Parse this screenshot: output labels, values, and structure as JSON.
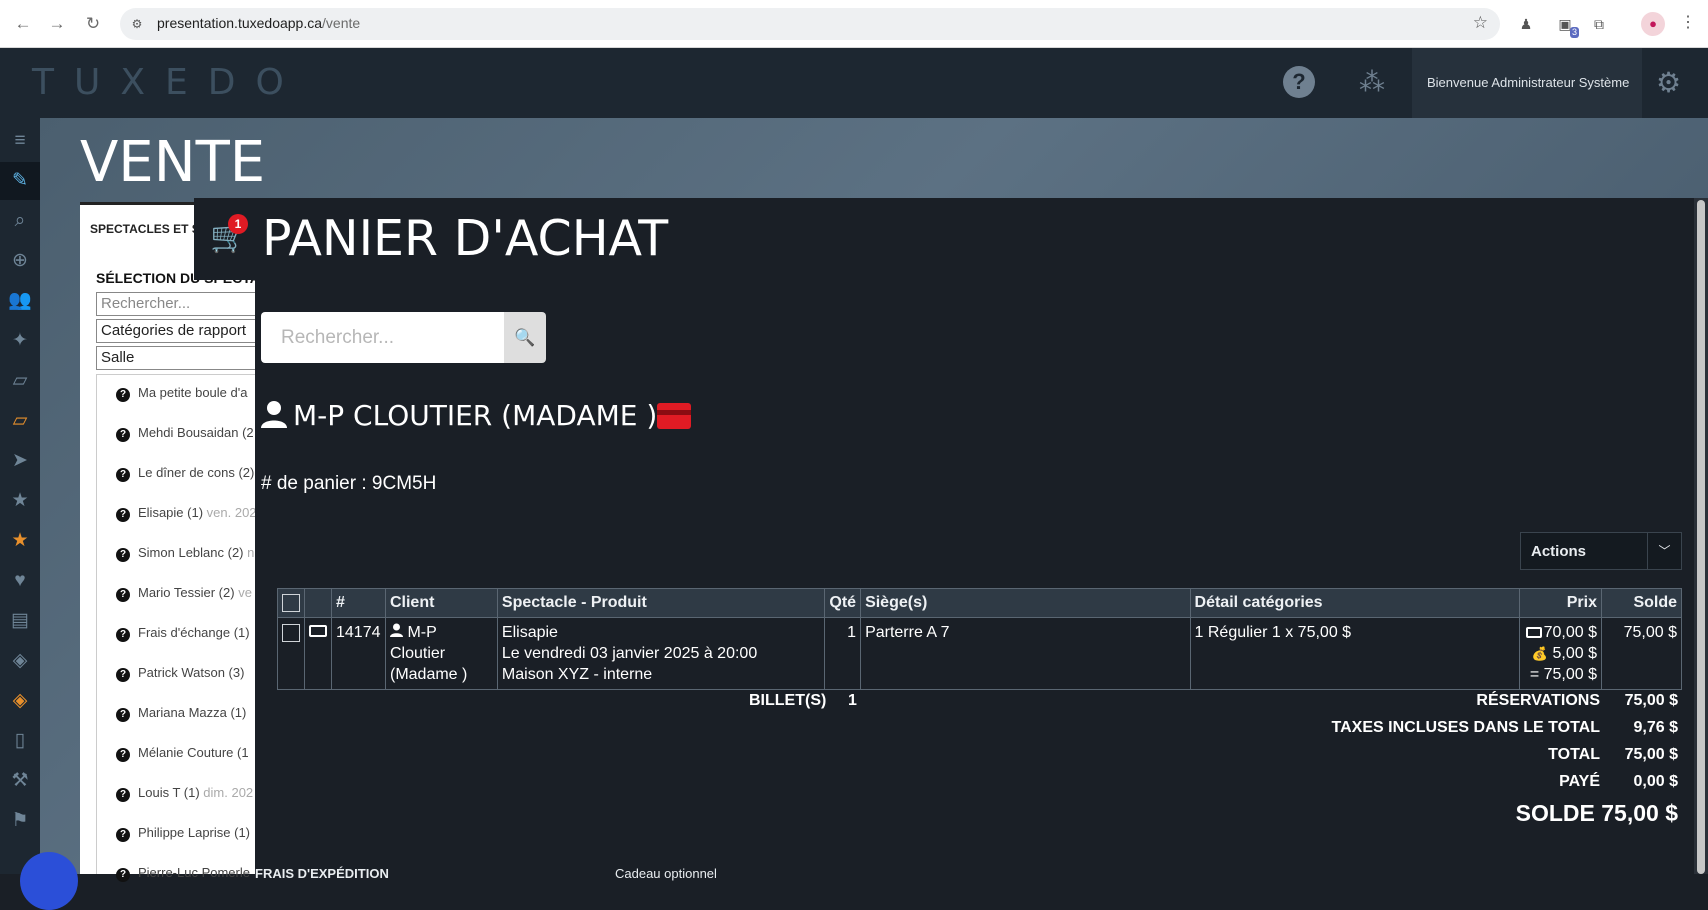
{
  "browser": {
    "url_domain": "presentation.tuxedoapp.ca",
    "url_path": "/vente",
    "extension_badge": "3"
  },
  "header": {
    "logo": "TUXEDO",
    "welcome": "Bienvenue Administrateur Système"
  },
  "page": {
    "title": "VENTE"
  },
  "left_panel": {
    "tab_label": "SPECTACLES ET SE",
    "section_label": "SÉLECTION DU SPECTA",
    "search_placeholder": "Rechercher...",
    "category_value": "Catégories de rapport",
    "venue_value": "Salle",
    "items": [
      {
        "name": "Ma petite boule d'a",
        "extra": ""
      },
      {
        "name": "Mehdi Bousaidan (2",
        "extra": ""
      },
      {
        "name": "Le dîner de cons (2)",
        "extra": ""
      },
      {
        "name": "Elisapie (1)",
        "extra": "ven. 202"
      },
      {
        "name": "Simon Leblanc (2)",
        "extra": "n"
      },
      {
        "name": "Mario Tessier (2)",
        "extra": "ve"
      },
      {
        "name": "Frais d'échange (1)",
        "extra": ""
      },
      {
        "name": "Patrick Watson (3)",
        "extra": ""
      },
      {
        "name": "Mariana Mazza (1)",
        "extra": ""
      },
      {
        "name": "Mélanie Couture (1",
        "extra": ""
      },
      {
        "name": "Louis T (1)",
        "extra": "dim. 202"
      },
      {
        "name": "Philippe Laprise (1)",
        "extra": ""
      },
      {
        "name": "Pierre-Luc Pomerle",
        "extra": ""
      }
    ]
  },
  "cart": {
    "badge_count": "1",
    "title": "PANIER D'ACHAT",
    "search_placeholder": "Rechercher...",
    "client_name": "M-P CLOUTIER (MADAME )",
    "cart_number_label": "# de panier : 9CM5H",
    "actions_label": "Actions",
    "table": {
      "headers": {
        "hash": "#",
        "client": "Client",
        "show": "Spectacle - Produit",
        "qty": "Qté",
        "seats": "Siège(s)",
        "categories": "Détail catégories",
        "price": "Prix",
        "balance": "Solde"
      },
      "rows": [
        {
          "id": "14174",
          "client_line1": "M-P",
          "client_line2": "Cloutier",
          "client_line3": "(Madame )",
          "show_line1": "Elisapie",
          "show_line2": "Le vendredi 03 janvier 2025 à 20:00",
          "show_line3": "Maison XYZ - interne",
          "qty": "1",
          "seats": "Parterre A 7",
          "categories": "1 Régulier 1 x 75,00 $",
          "price_ticket": "70,00 $",
          "price_fee": "5,00 $",
          "price_total_sign": "=",
          "price_total": "75,00 $",
          "balance": "75,00 $"
        }
      ]
    },
    "totals": {
      "tickets_label": "BILLET(S)",
      "tickets_value": "1",
      "reservations_label": "RÉSERVATIONS",
      "reservations_value": "75,00 $",
      "taxes_label": "TAXES INCLUSES DANS LE TOTAL",
      "taxes_value": "9,76 $",
      "total_label": "TOTAL",
      "total_value": "75,00 $",
      "paid_label": "PAYÉ",
      "paid_value": "0,00 $",
      "balance_big": "SOLDE 75,00 $"
    },
    "bottom_left": "FRAIS D'EXPÉDITION",
    "bottom_right": "Cadeau optionnel"
  },
  "colors": {
    "header_bg": "#1d2731",
    "cart_bg": "#1a1f26",
    "accent_orange": "#e8902c",
    "badge_red": "#e01b24"
  }
}
